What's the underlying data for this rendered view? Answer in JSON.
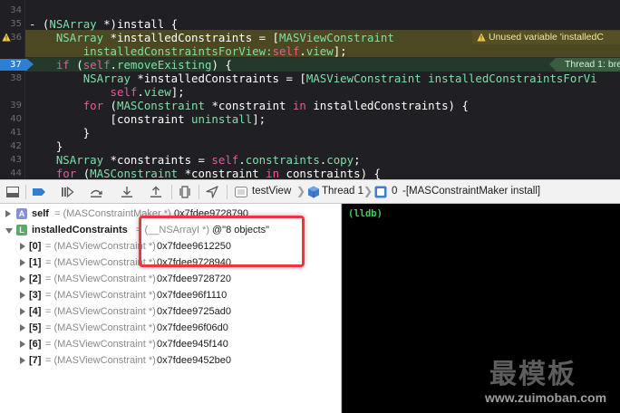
{
  "editor": {
    "lines": [
      {
        "num": "34",
        "segments": [
          {
            "t": "",
            "c": "pl"
          }
        ]
      },
      {
        "num": "35",
        "segments": [
          {
            "t": "- (",
            "c": "pl"
          },
          {
            "t": "NSArray",
            "c": "ty"
          },
          {
            "t": " *)install {",
            "c": "pl"
          }
        ]
      },
      {
        "num": "36",
        "segments": [
          {
            "t": "    ",
            "c": "pl"
          },
          {
            "t": "NSArray",
            "c": "ty"
          },
          {
            "t": " *installedConstraints = [",
            "c": "pl"
          },
          {
            "t": "MASViewConstraint",
            "c": "ty"
          }
        ]
      },
      {
        "num": "",
        "segments": [
          {
            "t": "        ",
            "c": "pl"
          },
          {
            "t": "installedConstraintsForView:",
            "c": "ty"
          },
          {
            "t": "self",
            "c": "kw"
          },
          {
            "t": ".",
            "c": "pl"
          },
          {
            "t": "view",
            "c": "ty"
          },
          {
            "t": "];",
            "c": "pl"
          }
        ]
      },
      {
        "num": "37",
        "segments": [
          {
            "t": "    ",
            "c": "pl"
          },
          {
            "t": "if",
            "c": "kw"
          },
          {
            "t": " (",
            "c": "pl"
          },
          {
            "t": "self",
            "c": "kw"
          },
          {
            "t": ".",
            "c": "pl"
          },
          {
            "t": "removeExisting",
            "c": "ty"
          },
          {
            "t": ") {",
            "c": "pl"
          }
        ]
      },
      {
        "num": "38",
        "segments": [
          {
            "t": "        ",
            "c": "pl"
          },
          {
            "t": "NSArray",
            "c": "ty"
          },
          {
            "t": " *installedConstraints = [",
            "c": "pl"
          },
          {
            "t": "MASViewConstraint",
            "c": "ty"
          },
          {
            "t": " ",
            "c": "pl"
          },
          {
            "t": "installedConstraintsForVi",
            "c": "ty"
          }
        ]
      },
      {
        "num": "",
        "segments": [
          {
            "t": "            ",
            "c": "pl"
          },
          {
            "t": "self",
            "c": "kw"
          },
          {
            "t": ".",
            "c": "pl"
          },
          {
            "t": "view",
            "c": "ty"
          },
          {
            "t": "];",
            "c": "pl"
          }
        ]
      },
      {
        "num": "39",
        "segments": [
          {
            "t": "        ",
            "c": "pl"
          },
          {
            "t": "for",
            "c": "kw"
          },
          {
            "t": " (",
            "c": "pl"
          },
          {
            "t": "MASConstraint",
            "c": "ty"
          },
          {
            "t": " *constraint ",
            "c": "pl"
          },
          {
            "t": "in",
            "c": "kw"
          },
          {
            "t": " installedConstraints) {",
            "c": "pl"
          }
        ]
      },
      {
        "num": "40",
        "segments": [
          {
            "t": "            [constraint ",
            "c": "pl"
          },
          {
            "t": "uninstall",
            "c": "ty"
          },
          {
            "t": "];",
            "c": "pl"
          }
        ]
      },
      {
        "num": "41",
        "segments": [
          {
            "t": "        }",
            "c": "pl"
          }
        ]
      },
      {
        "num": "42",
        "segments": [
          {
            "t": "    }",
            "c": "pl"
          }
        ]
      },
      {
        "num": "43",
        "segments": [
          {
            "t": "    ",
            "c": "pl"
          },
          {
            "t": "NSArray",
            "c": "ty"
          },
          {
            "t": " *constraints = ",
            "c": "pl"
          },
          {
            "t": "self",
            "c": "kw"
          },
          {
            "t": ".",
            "c": "pl"
          },
          {
            "t": "constraints",
            "c": "ty"
          },
          {
            "t": ".",
            "c": "pl"
          },
          {
            "t": "copy",
            "c": "ty"
          },
          {
            "t": ";",
            "c": "pl"
          }
        ]
      },
      {
        "num": "44",
        "segments": [
          {
            "t": "    ",
            "c": "pl"
          },
          {
            "t": "for",
            "c": "kw"
          },
          {
            "t": " (",
            "c": "pl"
          },
          {
            "t": "MASConstraint",
            "c": "ty"
          },
          {
            "t": " *constraint ",
            "c": "pl"
          },
          {
            "t": "in",
            "c": "kw"
          },
          {
            "t": " constraints) {",
            "c": "pl"
          }
        ]
      }
    ],
    "current_line_marker": "37",
    "warning_badge": "Unused variable 'installedC",
    "thread_badge": "Thread 1: bre",
    "colors": {
      "keyword": "#e9599c",
      "type": "#7ee0a7",
      "warning_bg": "#4b4822",
      "debug_bg": "#25392a",
      "marker": "#2f7ed2"
    }
  },
  "debugbar": {
    "buttons": [
      "hide-debug-area-icon",
      "breakpoints-toggle-icon",
      "continue-icon",
      "step-over-icon",
      "step-into-icon",
      "step-out-icon",
      "view-hierarchy-icon",
      "simulate-location-icon"
    ],
    "breadcrumb": {
      "target": "testView",
      "thread": "Thread 1",
      "frame_num": "0",
      "frame": "-[MASConstraintMaker install]"
    }
  },
  "variables": {
    "rows": [
      {
        "badge": "A",
        "name": "self",
        "type": "= (MASConstraintMaker *)",
        "value": "0x7fdee9728790",
        "expanded": false
      },
      {
        "badge": "L",
        "name": "installedConstraints",
        "type": "= (__NSArrayI *)",
        "value": "@\"8 objects\"",
        "expanded": true
      },
      {
        "name": "[0]",
        "type": "= (MASViewConstraint *)",
        "value": "0x7fdee9612250"
      },
      {
        "name": "[1]",
        "type": "= (MASViewConstraint *)",
        "value": "0x7fdee9728940"
      },
      {
        "name": "[2]",
        "type": "= (MASViewConstraint *)",
        "value": "0x7fdee9728720"
      },
      {
        "name": "[3]",
        "type": "= (MASViewConstraint *)",
        "value": "0x7fdee96f1110"
      },
      {
        "name": "[4]",
        "type": "= (MASViewConstraint *)",
        "value": "0x7fdee9725ad0"
      },
      {
        "name": "[5]",
        "type": "= (MASViewConstraint *)",
        "value": "0x7fdee96f06d0"
      },
      {
        "name": "[6]",
        "type": "= (MASViewConstraint *)",
        "value": "0x7fdee945f140"
      },
      {
        "name": "[7]",
        "type": "= (MASViewConstraint *)",
        "value": "0x7fdee9452be0"
      }
    ]
  },
  "console": {
    "prompt": "(lldb)"
  },
  "watermark": {
    "logo_text": "最模板",
    "url": "www.zuimoban.com"
  }
}
